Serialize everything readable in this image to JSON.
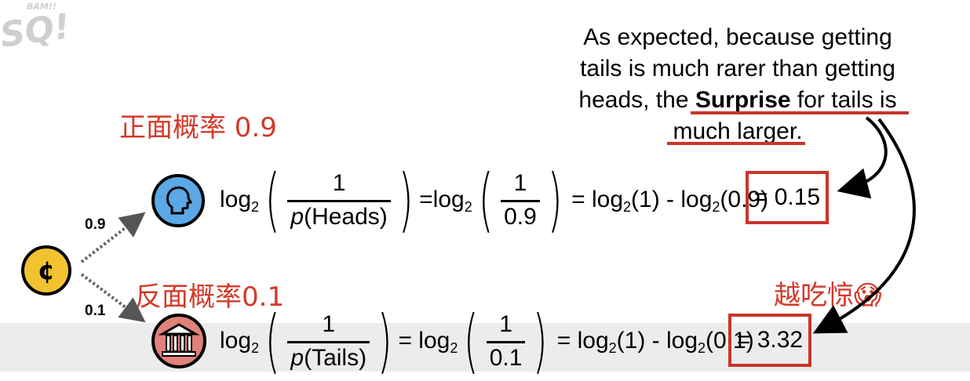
{
  "logo": {
    "top": "BAM!!",
    "main": "SQ!"
  },
  "annotation": {
    "line1": "As expected, because getting",
    "line2": "tails is much rarer than getting",
    "line3a": "heads, the ",
    "line3b": "Surprise",
    "line3c": " for tails is",
    "line4": "much larger."
  },
  "heads_label": "正面概率 0.9",
  "tails_label": "反面概率0.1",
  "surprise_label": "越吃惊😱",
  "branch": {
    "heads_prob": "0.9",
    "tails_prob": "0.1"
  },
  "coin_symbol": "¢",
  "heads_eq": {
    "log": "log",
    "sub": "2",
    "num1": "1",
    "den1_p": "p",
    "den1_rest": "(Heads)",
    "eq1": "=log",
    "sub2": "2",
    "num2": "1",
    "den2": "0.9",
    "rest": "= log",
    "rest_sub": "2",
    "rest2": "(1) - log",
    "rest_sub2": "2",
    "rest3": "(0.9)",
    "result": "= 0.15"
  },
  "tails_eq": {
    "log": "log",
    "sub": "2",
    "num1": "1",
    "den1_p": "p",
    "den1_rest": "(Tails)",
    "eq1": "= log",
    "sub2": "2",
    "num2": "1",
    "den2": "0.1",
    "rest": "= log",
    "rest_sub": "2",
    "rest2": "(1) - log",
    "rest_sub2": "2",
    "rest3": "(0.1)",
    "result": "= 3.32"
  },
  "colors": {
    "accent": "#d23a2a",
    "coin": "#f2c230",
    "heads_icon": "#5aa9e6",
    "tails_icon": "#e0827a"
  }
}
